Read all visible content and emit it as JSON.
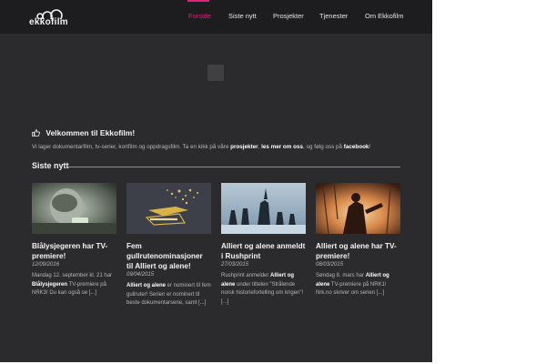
{
  "header": {
    "logo_text": "ekkofilm",
    "nav": [
      {
        "label": "Forside",
        "active": true
      },
      {
        "label": "Siste nytt",
        "active": false
      },
      {
        "label": "Prosjekter",
        "active": false
      },
      {
        "label": "Tjenester",
        "active": false
      },
      {
        "label": "Om Ekkofilm",
        "active": false
      }
    ]
  },
  "welcome": {
    "title": "Velkommen til Ekkofilm!",
    "intro_prefix": "Vi lager dokumentarfilm, tv-serier, kortfilm og oppdragsfilm. Ta en kikk på våre ",
    "link_projects": "prosjekter",
    "sep1": ", ",
    "link_more": "les mer om oss",
    "sep2": ", og følg oss på ",
    "link_facebook": "facebook",
    "intro_suffix": "!"
  },
  "news": {
    "title": "Siste nytt",
    "cards": [
      {
        "title": "Blålysjegeren har TV-premiere!",
        "date": "12/09/2016",
        "excerpt_1": "Mandag 12. september kl. 21 har ",
        "excerpt_bold": "Blålysjegeren",
        "excerpt_2": " TV-premiere på NRK3! Du kan også se [...]"
      },
      {
        "title": "Fem gullrutenominasjoner til Alliert og alene!",
        "date": "09/04/2015",
        "excerpt_bold": "Alliert og alene",
        "excerpt_2": " er nominert til fem gullruter! Serien er nominert til beste dokumentarserie, samt [...]"
      },
      {
        "title": "Alliert og alene anmeldt i Rushprint",
        "date": "27/03/2015",
        "excerpt_1": "Rushprint anmelder ",
        "excerpt_bold": "Alliert og alene",
        "excerpt_2": " under tittelen \"Strålende norsk historiefortelling om krigen\"! [...]"
      },
      {
        "title": "Alliert og alene har TV-premiere!",
        "date": "08/03/2015",
        "excerpt_1": "Søndag 8. mars har ",
        "excerpt_bold": "Alliert og alene",
        "excerpt_2": " TV-premiere på NRK1! Nrk.no skriver om serien [...]"
      }
    ]
  },
  "colors": {
    "accent": "#e0207a",
    "header_bg": "#1d1d1f",
    "page_bg": "#2b2b2e"
  }
}
